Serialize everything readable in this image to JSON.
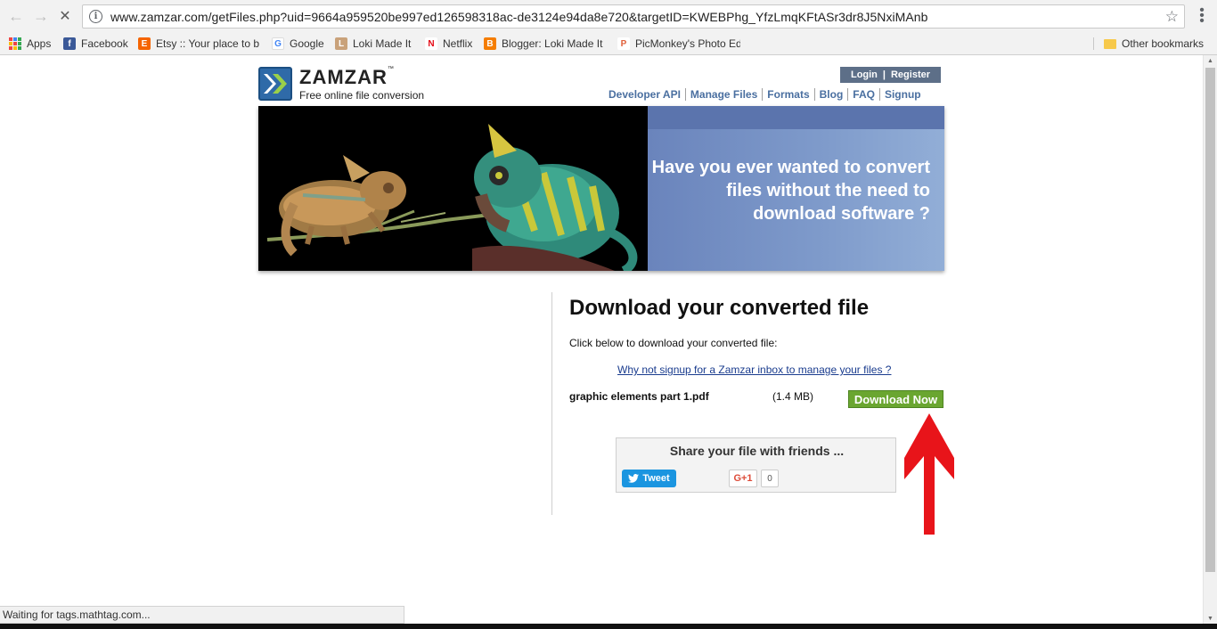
{
  "browser": {
    "url": "www.zamzar.com/getFiles.php?uid=9664a959520be997ed126598318ac-de3124e94da8e720&targetID=KWEBPhg_YfzLmqKFtASr3dr8J5NxiMAnb",
    "bookmarks": [
      {
        "label": "Apps",
        "icon": "apps-grid-icon"
      },
      {
        "label": "Facebook",
        "icon": "facebook-icon",
        "color": "#3b5998",
        "glyph": "f"
      },
      {
        "label": "Etsy :: Your place to bu",
        "icon": "etsy-icon",
        "color": "#f56400",
        "glyph": "E"
      },
      {
        "label": "Google",
        "icon": "google-icon",
        "color": "#4285f4",
        "glyph": "G"
      },
      {
        "label": "Loki Made It",
        "icon": "loki-icon",
        "color": "#c9a27a",
        "glyph": "L"
      },
      {
        "label": "Netflix",
        "icon": "netflix-icon",
        "color": "#e50914",
        "glyph": "N"
      },
      {
        "label": "Blogger: Loki Made It",
        "icon": "blogger-icon",
        "color": "#f57d00",
        "glyph": "B"
      },
      {
        "label": "PicMonkey's Photo Ed",
        "icon": "picmonkey-icon",
        "color": "#e0603a",
        "glyph": "P"
      }
    ],
    "other_bookmarks": "Other bookmarks",
    "status": "Waiting for tags.mathtag.com..."
  },
  "site": {
    "logo_name": "ZAMZAR",
    "logo_tm": "™",
    "tagline": "Free online file conversion",
    "login": "Login",
    "separator": "|",
    "register": "Register",
    "nav": [
      "Developer API",
      "Manage Files",
      "Formats",
      "Blog",
      "FAQ",
      "Signup"
    ],
    "banner_text": "Have you ever wanted to convert files without the need to download software ?"
  },
  "download": {
    "title": "Download your converted file",
    "instruction": "Click below to download your converted file:",
    "signup_link": "Why not signup for a Zamzar inbox to manage your files ?",
    "file_name": "graphic elements part 1.pdf",
    "file_size": "(1.4 MB)",
    "button": "Download Now"
  },
  "share": {
    "title": "Share your file with friends ...",
    "tweet": "Tweet",
    "gplus": "G+1",
    "gplus_count": "0"
  },
  "colors": {
    "download_button": "#6aa630",
    "nav_link": "#4a6fa0",
    "login_bg": "#5d6f88",
    "arrow": "#e8141a"
  }
}
